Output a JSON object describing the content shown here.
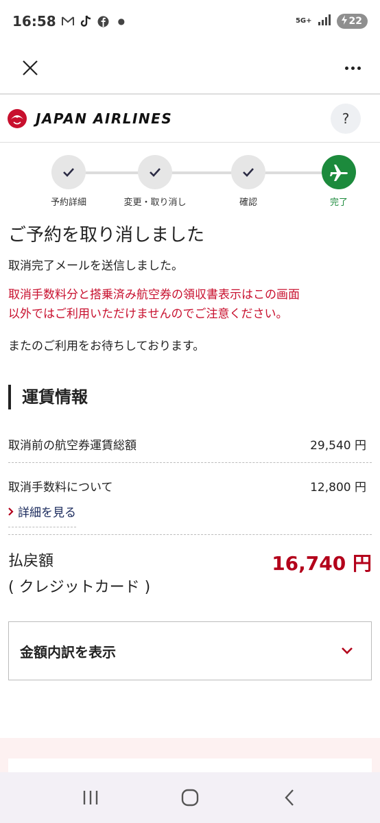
{
  "status_bar": {
    "time": "16:58",
    "network": "5G+",
    "battery": "22",
    "notification_icons": [
      "gmail-icon",
      "tiktok-icon",
      "facebook-icon"
    ]
  },
  "brand": {
    "name": "JAPAN AIRLINES",
    "logo_color": "#c8102e"
  },
  "help_label": "?",
  "stepper": {
    "steps": [
      {
        "label": "予約詳細",
        "state": "done"
      },
      {
        "label": "変更・取り消し",
        "state": "done"
      },
      {
        "label": "確認",
        "state": "done"
      },
      {
        "label": "完了",
        "state": "current"
      }
    ],
    "active_color": "#1c8a3c"
  },
  "main": {
    "title": "ご予約を取り消しました",
    "sub": "取消完了メールを送信しました。",
    "warning_line1": "取消手数料分と搭乗済み航空券の領収書表示はこの画面",
    "warning_line2": "以外ではご利用いただけませんのでご注意ください。",
    "thanks": "またのご利用をお待ちしております。"
  },
  "fare": {
    "heading": "運賃情報",
    "total_label": "取消前の航空券運賃総額",
    "total_value": "29,540 円",
    "fee_label": "取消手数料について",
    "fee_value": "12,800 円",
    "detail_link": "詳細を見る",
    "refund_label_1": "払戻額",
    "refund_label_2": "( クレジットカード )",
    "refund_value": "16,740 円",
    "breakdown_label": "金額内訳を表示"
  },
  "colors": {
    "warning": "#c8102e",
    "refund": "#b3001b",
    "link": "#1a2a5c"
  }
}
